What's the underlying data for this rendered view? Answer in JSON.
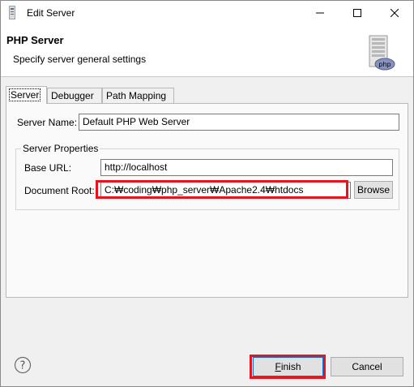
{
  "window": {
    "title": "Edit Server"
  },
  "banner": {
    "title": "PHP Server",
    "description": "Specify server general settings",
    "icon": "php-server-icon",
    "icon_badge": "php"
  },
  "tabs": [
    {
      "label": "Server",
      "active": true
    },
    {
      "label": "Debugger",
      "active": false
    },
    {
      "label": "Path Mapping",
      "active": false
    }
  ],
  "server": {
    "name_label": "Server Name:",
    "name_value": "Default PHP Web Server",
    "properties_legend": "Server Properties",
    "base_url_label": "Base URL:",
    "base_url_value": "http://localhost",
    "document_root_label": "Document Root:",
    "document_root_value": "C:₩coding₩php_server₩Apache2.4₩htdocs",
    "browse_label": "Browse"
  },
  "footer": {
    "help_icon": "help-icon",
    "finish_label": "Finish",
    "cancel_label": "Cancel"
  },
  "colors": {
    "highlight": "#e8141d",
    "default_button_border": "#0078d7"
  }
}
